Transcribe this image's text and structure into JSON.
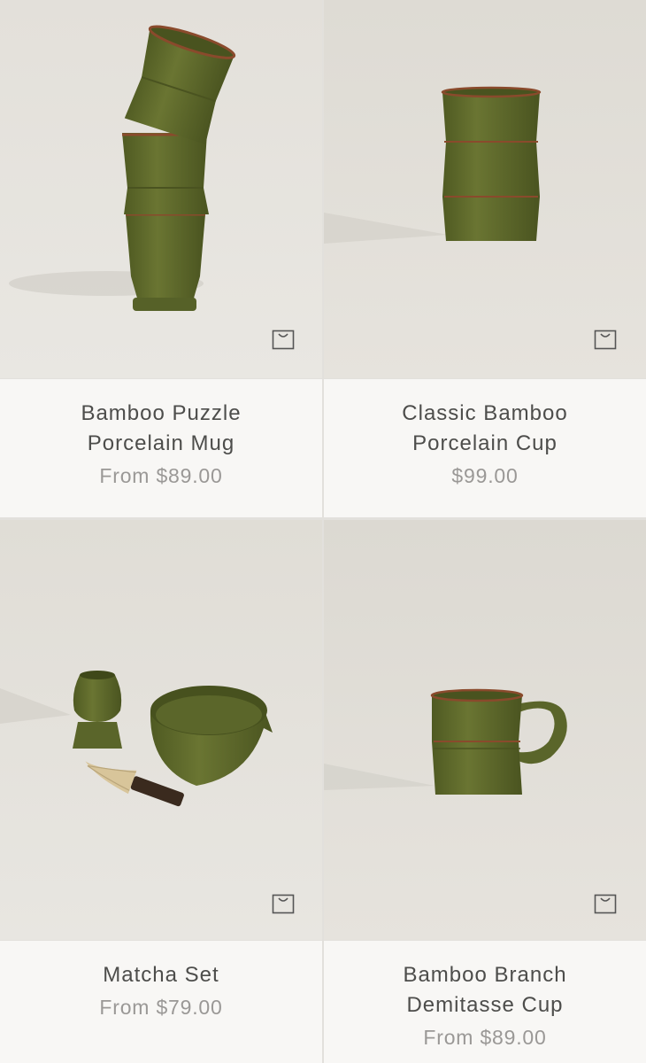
{
  "products": [
    {
      "title_lines": [
        "Bamboo Puzzle",
        "Porcelain Mug"
      ],
      "price": "From $89.00",
      "image": "stacked-bamboo-cups",
      "cart_icon": "shopping-bag-icon"
    },
    {
      "title_lines": [
        "Classic Bamboo",
        "Porcelain Cup"
      ],
      "price": "$99.00",
      "image": "single-bamboo-cup",
      "cart_icon": "shopping-bag-icon"
    },
    {
      "title_lines": [
        "Matcha Set"
      ],
      "price": "From $79.00",
      "image": "matcha-bowl-whisk-holder",
      "cart_icon": "shopping-bag-icon"
    },
    {
      "title_lines": [
        "Bamboo Branch",
        "Demitasse Cup"
      ],
      "price": "From $89.00",
      "image": "bamboo-handle-mug",
      "cart_icon": "shopping-bag-icon"
    }
  ],
  "colors": {
    "ceramic_green": "#5f6a2c",
    "rim_brown": "#8a4a2c",
    "background": "#e6e3dd",
    "info_panel": "#f8f7f5"
  }
}
